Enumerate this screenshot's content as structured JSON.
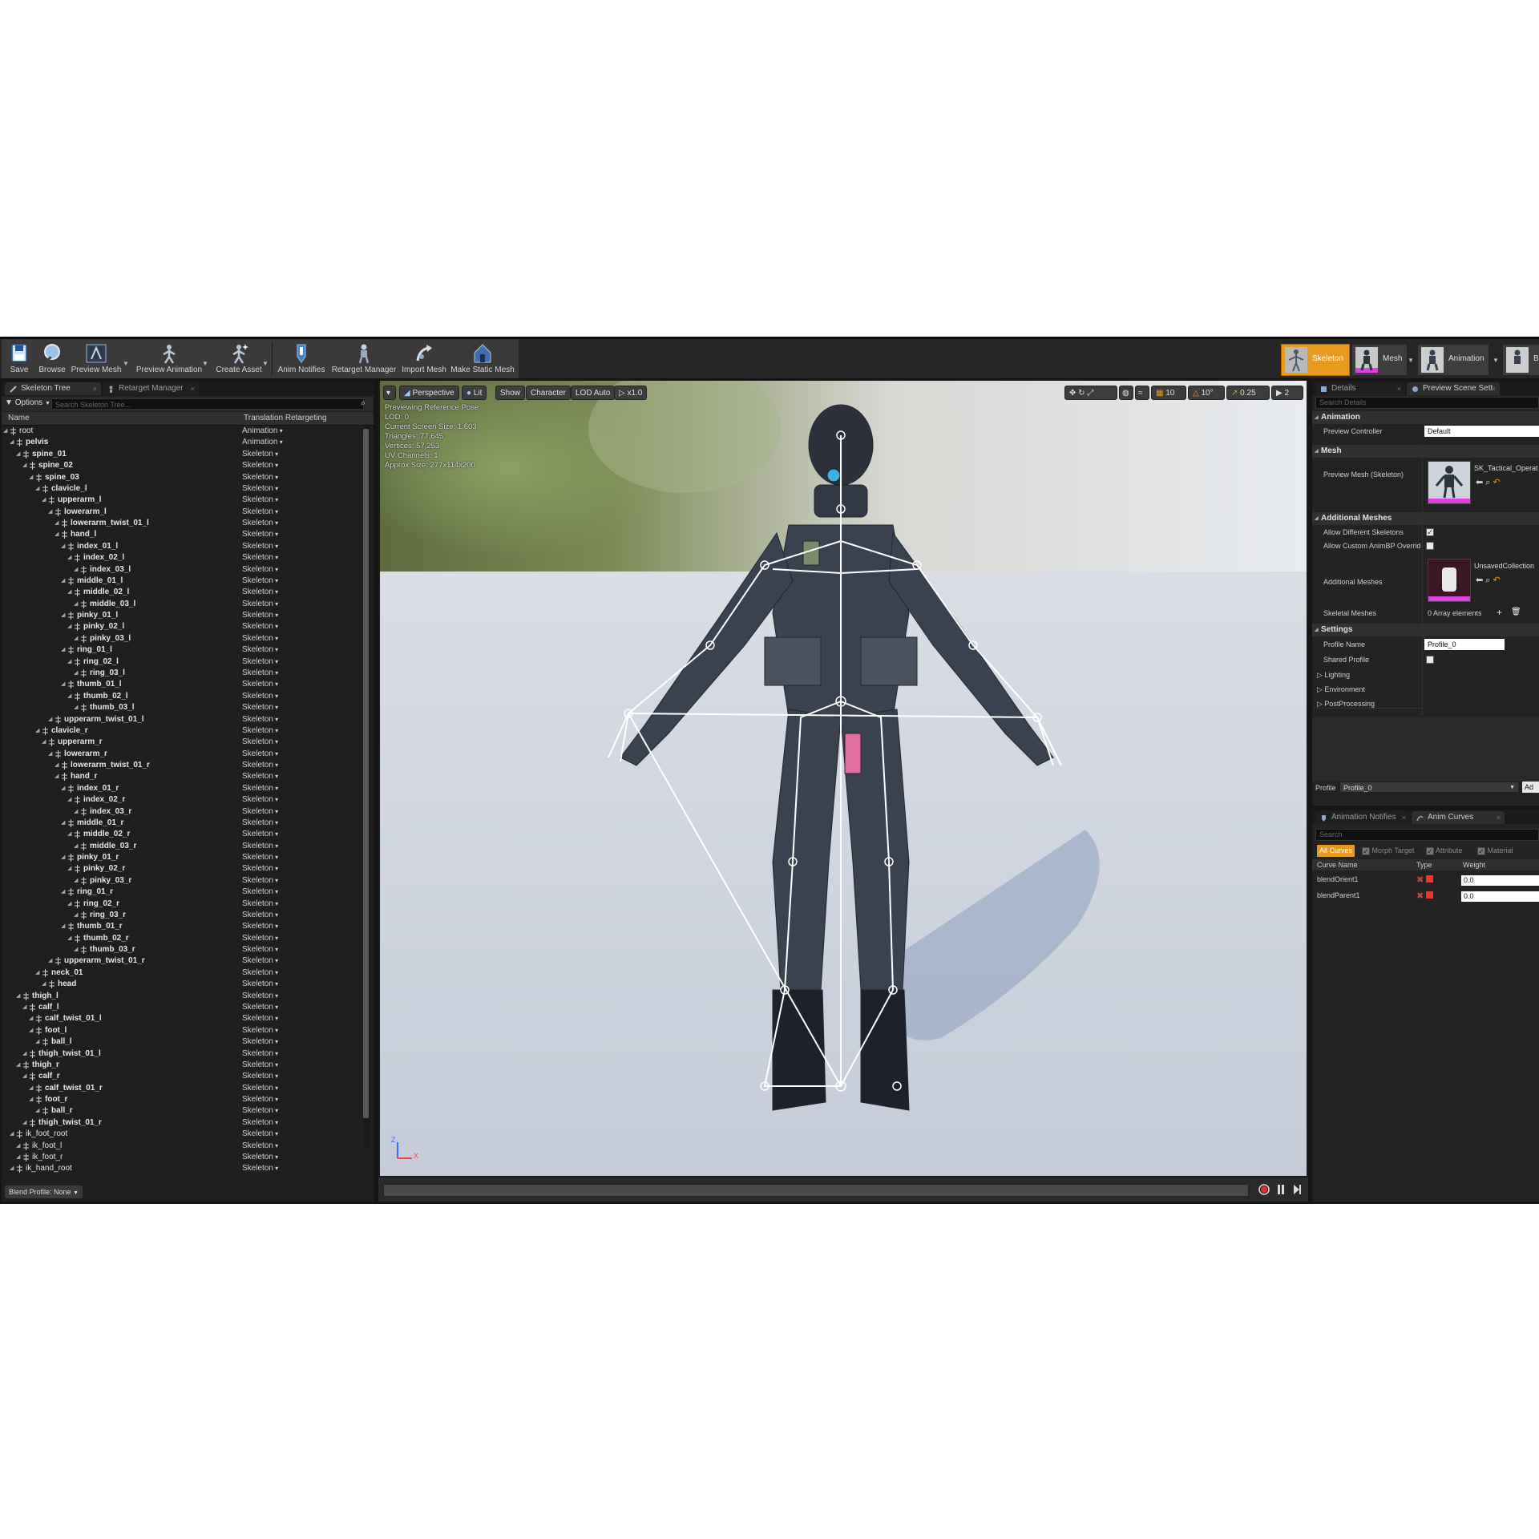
{
  "toolbar": {
    "buttons": [
      {
        "label": "Save",
        "icon": "save-icon"
      },
      {
        "label": "Browse",
        "icon": "browse-icon"
      },
      {
        "label": "Preview Mesh",
        "icon": "preview-mesh-icon"
      },
      {
        "label": "Preview Animation",
        "icon": "preview-animation-icon"
      },
      {
        "label": "Create Asset",
        "icon": "create-asset-icon"
      },
      {
        "label": "Anim Notifies",
        "icon": "anim-notifies-icon"
      },
      {
        "label": "Retarget Manager",
        "icon": "retarget-manager-icon"
      },
      {
        "label": "Import Mesh",
        "icon": "import-mesh-icon"
      },
      {
        "label": "Make Static Mesh",
        "icon": "make-static-mesh-icon"
      }
    ],
    "modes": [
      {
        "label": "Skeleton",
        "active": true
      },
      {
        "label": "Mesh",
        "active": false
      },
      {
        "label": "Animation",
        "active": false
      },
      {
        "label": "B",
        "active": false
      }
    ]
  },
  "skeleton_panel": {
    "tabs": [
      "Skeleton Tree",
      "Retarget Manager"
    ],
    "options_label": "Options",
    "search_placeholder": "Search Skeleton Tree...",
    "col_name": "Name",
    "col_retarget": "Translation Retargeting",
    "blend_profile": "Blend Profile: None",
    "bones": [
      {
        "name": "root",
        "depth": 0,
        "type": "Animation",
        "bold": false
      },
      {
        "name": "pelvis",
        "depth": 1,
        "type": "Animation",
        "bold": true
      },
      {
        "name": "spine_01",
        "depth": 2,
        "type": "Skeleton",
        "bold": true
      },
      {
        "name": "spine_02",
        "depth": 3,
        "type": "Skeleton",
        "bold": true
      },
      {
        "name": "spine_03",
        "depth": 4,
        "type": "Skeleton",
        "bold": true
      },
      {
        "name": "clavicle_l",
        "depth": 5,
        "type": "Skeleton",
        "bold": true
      },
      {
        "name": "upperarm_l",
        "depth": 6,
        "type": "Skeleton",
        "bold": true
      },
      {
        "name": "lowerarm_l",
        "depth": 7,
        "type": "Skeleton",
        "bold": true
      },
      {
        "name": "lowerarm_twist_01_l",
        "depth": 8,
        "type": "Skeleton",
        "bold": true
      },
      {
        "name": "hand_l",
        "depth": 8,
        "type": "Skeleton",
        "bold": true
      },
      {
        "name": "index_01_l",
        "depth": 9,
        "type": "Skeleton",
        "bold": true
      },
      {
        "name": "index_02_l",
        "depth": 10,
        "type": "Skeleton",
        "bold": true
      },
      {
        "name": "index_03_l",
        "depth": 11,
        "type": "Skeleton",
        "bold": true
      },
      {
        "name": "middle_01_l",
        "depth": 9,
        "type": "Skeleton",
        "bold": true
      },
      {
        "name": "middle_02_l",
        "depth": 10,
        "type": "Skeleton",
        "bold": true
      },
      {
        "name": "middle_03_l",
        "depth": 11,
        "type": "Skeleton",
        "bold": true
      },
      {
        "name": "pinky_01_l",
        "depth": 9,
        "type": "Skeleton",
        "bold": true
      },
      {
        "name": "pinky_02_l",
        "depth": 10,
        "type": "Skeleton",
        "bold": true
      },
      {
        "name": "pinky_03_l",
        "depth": 11,
        "type": "Skeleton",
        "bold": true
      },
      {
        "name": "ring_01_l",
        "depth": 9,
        "type": "Skeleton",
        "bold": true
      },
      {
        "name": "ring_02_l",
        "depth": 10,
        "type": "Skeleton",
        "bold": true
      },
      {
        "name": "ring_03_l",
        "depth": 11,
        "type": "Skeleton",
        "bold": true
      },
      {
        "name": "thumb_01_l",
        "depth": 9,
        "type": "Skeleton",
        "bold": true
      },
      {
        "name": "thumb_02_l",
        "depth": 10,
        "type": "Skeleton",
        "bold": true
      },
      {
        "name": "thumb_03_l",
        "depth": 11,
        "type": "Skeleton",
        "bold": true
      },
      {
        "name": "upperarm_twist_01_l",
        "depth": 7,
        "type": "Skeleton",
        "bold": true
      },
      {
        "name": "clavicle_r",
        "depth": 5,
        "type": "Skeleton",
        "bold": true
      },
      {
        "name": "upperarm_r",
        "depth": 6,
        "type": "Skeleton",
        "bold": true
      },
      {
        "name": "lowerarm_r",
        "depth": 7,
        "type": "Skeleton",
        "bold": true
      },
      {
        "name": "lowerarm_twist_01_r",
        "depth": 8,
        "type": "Skeleton",
        "bold": true
      },
      {
        "name": "hand_r",
        "depth": 8,
        "type": "Skeleton",
        "bold": true
      },
      {
        "name": "index_01_r",
        "depth": 9,
        "type": "Skeleton",
        "bold": true
      },
      {
        "name": "index_02_r",
        "depth": 10,
        "type": "Skeleton",
        "bold": true
      },
      {
        "name": "index_03_r",
        "depth": 11,
        "type": "Skeleton",
        "bold": true
      },
      {
        "name": "middle_01_r",
        "depth": 9,
        "type": "Skeleton",
        "bold": true
      },
      {
        "name": "middle_02_r",
        "depth": 10,
        "type": "Skeleton",
        "bold": true
      },
      {
        "name": "middle_03_r",
        "depth": 11,
        "type": "Skeleton",
        "bold": true
      },
      {
        "name": "pinky_01_r",
        "depth": 9,
        "type": "Skeleton",
        "bold": true
      },
      {
        "name": "pinky_02_r",
        "depth": 10,
        "type": "Skeleton",
        "bold": true
      },
      {
        "name": "pinky_03_r",
        "depth": 11,
        "type": "Skeleton",
        "bold": true
      },
      {
        "name": "ring_01_r",
        "depth": 9,
        "type": "Skeleton",
        "bold": true
      },
      {
        "name": "ring_02_r",
        "depth": 10,
        "type": "Skeleton",
        "bold": true
      },
      {
        "name": "ring_03_r",
        "depth": 11,
        "type": "Skeleton",
        "bold": true
      },
      {
        "name": "thumb_01_r",
        "depth": 9,
        "type": "Skeleton",
        "bold": true
      },
      {
        "name": "thumb_02_r",
        "depth": 10,
        "type": "Skeleton",
        "bold": true
      },
      {
        "name": "thumb_03_r",
        "depth": 11,
        "type": "Skeleton",
        "bold": true
      },
      {
        "name": "upperarm_twist_01_r",
        "depth": 7,
        "type": "Skeleton",
        "bold": true
      },
      {
        "name": "neck_01",
        "depth": 5,
        "type": "Skeleton",
        "bold": true
      },
      {
        "name": "head",
        "depth": 6,
        "type": "Skeleton",
        "bold": true
      },
      {
        "name": "thigh_l",
        "depth": 2,
        "type": "Skeleton",
        "bold": true
      },
      {
        "name": "calf_l",
        "depth": 3,
        "type": "Skeleton",
        "bold": true
      },
      {
        "name": "calf_twist_01_l",
        "depth": 4,
        "type": "Skeleton",
        "bold": true
      },
      {
        "name": "foot_l",
        "depth": 4,
        "type": "Skeleton",
        "bold": true
      },
      {
        "name": "ball_l",
        "depth": 5,
        "type": "Skeleton",
        "bold": true
      },
      {
        "name": "thigh_twist_01_l",
        "depth": 3,
        "type": "Skeleton",
        "bold": true
      },
      {
        "name": "thigh_r",
        "depth": 2,
        "type": "Skeleton",
        "bold": true
      },
      {
        "name": "calf_r",
        "depth": 3,
        "type": "Skeleton",
        "bold": true
      },
      {
        "name": "calf_twist_01_r",
        "depth": 4,
        "type": "Skeleton",
        "bold": true
      },
      {
        "name": "foot_r",
        "depth": 4,
        "type": "Skeleton",
        "bold": true
      },
      {
        "name": "ball_r",
        "depth": 5,
        "type": "Skeleton",
        "bold": true
      },
      {
        "name": "thigh_twist_01_r",
        "depth": 3,
        "type": "Skeleton",
        "bold": true
      },
      {
        "name": "ik_foot_root",
        "depth": 1,
        "type": "Skeleton",
        "bold": false
      },
      {
        "name": "ik_foot_l",
        "depth": 2,
        "type": "Skeleton",
        "bold": false
      },
      {
        "name": "ik_foot_r",
        "depth": 2,
        "type": "Skeleton",
        "bold": false
      },
      {
        "name": "ik_hand_root",
        "depth": 1,
        "type": "Skeleton",
        "bold": false
      }
    ]
  },
  "viewport": {
    "buttons": [
      "Perspective",
      "Lit",
      "Show",
      "Character",
      "LOD Auto",
      "x1.0"
    ],
    "right_values": [
      "10",
      "10°",
      "0.25",
      "2"
    ],
    "stats": [
      "Previewing Reference Pose",
      "LOD: 0",
      "Current Screen Size: 1.603",
      "Triangles: 77,645",
      "Vertices: 57,253",
      "UV Channels: 1",
      "Approx Size: 277x114x200"
    ],
    "axis_z": "Z",
    "axis_x": "X"
  },
  "details": {
    "tabs": [
      "Details",
      "Preview Scene Sett"
    ],
    "search_placeholder": "Search Details",
    "cat_animation": "Animation",
    "preview_controller_label": "Preview Controller",
    "preview_controller_value": "Default",
    "cat_mesh": "Mesh",
    "preview_mesh_label": "Preview Mesh (Skeleton)",
    "preview_mesh_value": "SK_Tactical_Operat",
    "cat_additional": "Additional Meshes",
    "allow_different_label": "Allow Different Skeletons",
    "allow_different_checked": true,
    "allow_custom_label": "Allow Custom AnimBP Overrid",
    "allow_custom_checked": false,
    "additional_meshes_label": "Additional Meshes",
    "additional_meshes_value": "UnsavedCollection",
    "skeletal_meshes_label": "Skeletal Meshes",
    "skeletal_meshes_value": "0 Array elements",
    "cat_settings": "Settings",
    "profile_name_label": "Profile Name",
    "profile_name_value": "Profile_0",
    "shared_profile_label": "Shared Profile",
    "lighting_label": "Lighting",
    "environment_label": "Environment",
    "postprocessing_label": "PostProcessing",
    "profile_label": "Profile",
    "profile_value": "Profile_0",
    "add_label": "Ad"
  },
  "curves": {
    "tabs": [
      "Animation Notifies",
      "Anim Curves"
    ],
    "search_placeholder": "Search",
    "filters": [
      "All Curves",
      "Morph Target",
      "Attribute",
      "Material"
    ],
    "col_name": "Curve Name",
    "col_type": "Type",
    "col_weight": "Weight",
    "rows": [
      {
        "name": "blendOrient1",
        "weight": "0.0"
      },
      {
        "name": "blendParent1",
        "weight": "0.0"
      }
    ]
  },
  "colors": {
    "accent": "#e79a1e",
    "panel": "#242424",
    "viewport_floor": "#c3c9d4"
  }
}
